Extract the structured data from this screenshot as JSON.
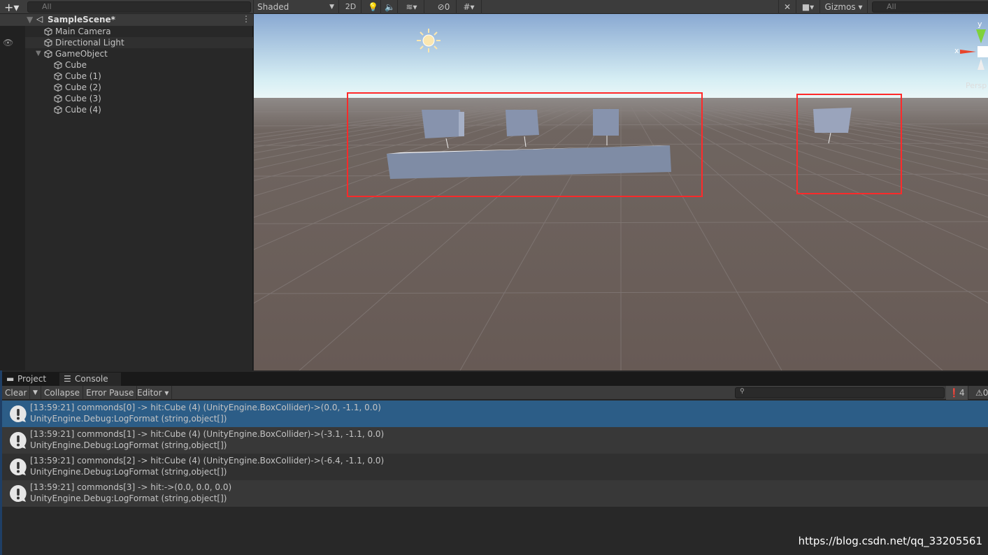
{
  "hierarchy": {
    "search_placeholder": "All",
    "scene_name": "SampleScene*",
    "items": [
      {
        "label": "Main Camera",
        "depth": 1
      },
      {
        "label": "Directional Light",
        "depth": 1
      },
      {
        "label": "GameObject",
        "depth": 1,
        "expanded": true
      },
      {
        "label": "Cube",
        "depth": 2
      },
      {
        "label": "Cube (1)",
        "depth": 2
      },
      {
        "label": "Cube (2)",
        "depth": 2
      },
      {
        "label": "Cube (3)",
        "depth": 2
      },
      {
        "label": "Cube (4)",
        "depth": 2
      }
    ]
  },
  "scene_toolbar": {
    "draw_mode": "Shaded",
    "mode_2d": "2D",
    "hidden_count": "0",
    "gizmos": "Gizmos",
    "search_placeholder": "All",
    "gizmo_x": "x",
    "gizmo_y": "y",
    "projection": "Persp"
  },
  "bottom": {
    "tabs": [
      {
        "label": "Project",
        "active": false
      },
      {
        "label": "Console",
        "active": true
      }
    ],
    "toolbar": {
      "clear": "Clear",
      "collapse": "Collapse",
      "error_pause": "Error Pause",
      "editor": "Editor",
      "log_count": "4",
      "warn_count": "0"
    },
    "logs": [
      {
        "line1": "[13:59:21] commonds[0] -> hit:Cube (4) (UnityEngine.BoxCollider)->(0.0, -1.1, 0.0)",
        "line2": "UnityEngine.Debug:LogFormat (string,object[])",
        "selected": true
      },
      {
        "line1": "[13:59:21] commonds[1] -> hit:Cube (4) (UnityEngine.BoxCollider)->(-3.1, -1.1, 0.0)",
        "line2": "UnityEngine.Debug:LogFormat (string,object[])"
      },
      {
        "line1": "[13:59:21] commonds[2] -> hit:Cube (4) (UnityEngine.BoxCollider)->(-6.4, -1.1, 0.0)",
        "line2": "UnityEngine.Debug:LogFormat (string,object[])"
      },
      {
        "line1": "[13:59:21] commonds[3] -> hit:->(0.0, 0.0, 0.0)",
        "line2": "UnityEngine.Debug:LogFormat (string,object[])"
      }
    ]
  },
  "watermark": "https://blog.csdn.net/qq_33205561",
  "colors": {
    "selection": "#2c5d87",
    "annotation_box": "#ff2a2a",
    "panel": "#282828",
    "toolbar": "#3c3c3c"
  }
}
